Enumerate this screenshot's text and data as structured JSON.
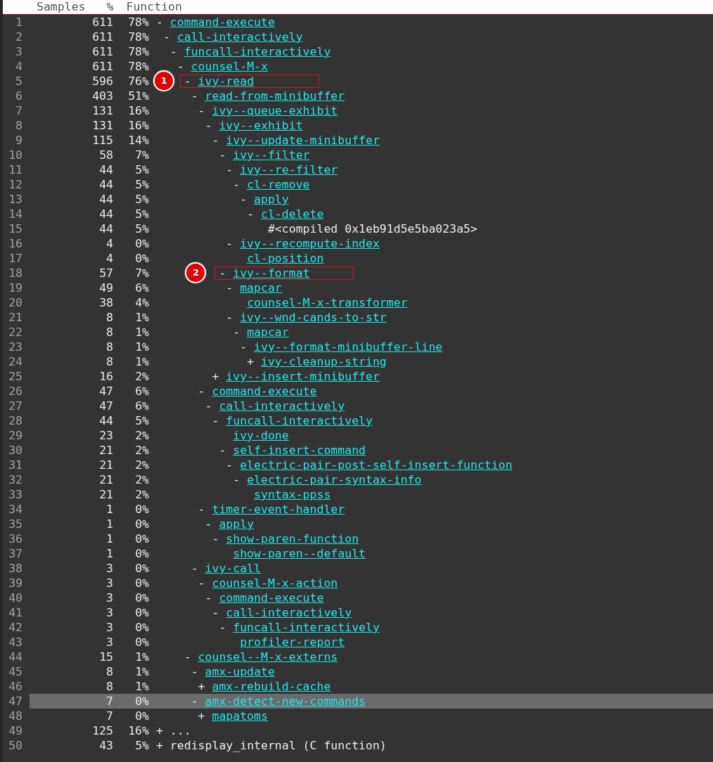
{
  "columns": [
    "Samples",
    "%",
    "Function"
  ],
  "tree": [
    {
      "line": "1",
      "samples": "611",
      "percent": "78%",
      "marker": "-",
      "name": "command-execute",
      "link": true,
      "selected": false,
      "children": [
        {
          "line": "2",
          "samples": "611",
          "percent": "78%",
          "marker": "-",
          "name": "call-interactively",
          "link": true,
          "selected": false,
          "children": [
            {
              "line": "3",
              "samples": "611",
              "percent": "78%",
              "marker": "-",
              "name": "funcall-interactively",
              "link": true,
              "selected": false,
              "children": [
                {
                  "line": "4",
                  "samples": "611",
                  "percent": "78%",
                  "marker": "-",
                  "name": "counsel-M-x",
                  "link": true,
                  "selected": false,
                  "children": [
                    {
                      "line": "5",
                      "samples": "596",
                      "percent": "76%",
                      "marker": "-",
                      "name": "ivy-read",
                      "link": true,
                      "selected": false,
                      "callout": "1",
                      "children": [
                        {
                          "line": "6",
                          "samples": "403",
                          "percent": "51%",
                          "marker": "-",
                          "name": "read-from-minibuffer",
                          "link": true,
                          "selected": false,
                          "children": [
                            {
                              "line": "7",
                              "samples": "131",
                              "percent": "16%",
                              "marker": "-",
                              "name": "ivy--queue-exhibit",
                              "link": true,
                              "selected": false,
                              "children": [
                                {
                                  "line": "8",
                                  "samples": "131",
                                  "percent": "16%",
                                  "marker": "-",
                                  "name": "ivy--exhibit",
                                  "link": true,
                                  "selected": false,
                                  "children": [
                                    {
                                      "line": "9",
                                      "samples": "115",
                                      "percent": "14%",
                                      "marker": "-",
                                      "name": "ivy--update-minibuffer",
                                      "link": true,
                                      "selected": false,
                                      "children": [
                                        {
                                          "line": "10",
                                          "samples": "58",
                                          "percent": "7%",
                                          "marker": "-",
                                          "name": "ivy--filter",
                                          "link": true,
                                          "selected": false,
                                          "children": [
                                            {
                                              "line": "11",
                                              "samples": "44",
                                              "percent": "5%",
                                              "marker": "-",
                                              "name": "ivy--re-filter",
                                              "link": true,
                                              "selected": false,
                                              "children": [
                                                {
                                                  "line": "12",
                                                  "samples": "44",
                                                  "percent": "5%",
                                                  "marker": "-",
                                                  "name": "cl-remove",
                                                  "link": true,
                                                  "selected": false,
                                                  "children": [
                                                    {
                                                      "line": "13",
                                                      "samples": "44",
                                                      "percent": "5%",
                                                      "marker": "-",
                                                      "name": "apply",
                                                      "link": true,
                                                      "selected": false,
                                                      "children": [
                                                        {
                                                          "line": "14",
                                                          "samples": "44",
                                                          "percent": "5%",
                                                          "marker": "-",
                                                          "name": "cl-delete",
                                                          "link": true,
                                                          "selected": false,
                                                          "children": [
                                                            {
                                                              "line": "15",
                                                              "samples": "44",
                                                              "percent": "5%",
                                                              "name": "#<compiled 0x1eb91d5e5ba023a5>",
                                                              "link": false,
                                                              "selected": false
                                                            }
                                                          ]
                                                        }
                                                      ]
                                                    }
                                                  ]
                                                }
                                              ]
                                            },
                                            {
                                              "line": "16",
                                              "samples": "4",
                                              "percent": "0%",
                                              "marker": "-",
                                              "name": "ivy--recompute-index",
                                              "link": true,
                                              "selected": false,
                                              "children": [
                                                {
                                                  "line": "17",
                                                  "samples": "4",
                                                  "percent": "0%",
                                                  "name": "cl-position",
                                                  "link": true,
                                                  "selected": false
                                                }
                                              ]
                                            }
                                          ]
                                        },
                                        {
                                          "line": "18",
                                          "samples": "57",
                                          "percent": "7%",
                                          "marker": "-",
                                          "name": "ivy--format",
                                          "link": true,
                                          "selected": false,
                                          "callout": "2",
                                          "children": [
                                            {
                                              "line": "19",
                                              "samples": "49",
                                              "percent": "6%",
                                              "marker": "-",
                                              "name": "mapcar",
                                              "link": true,
                                              "selected": false,
                                              "children": [
                                                {
                                                  "line": "20",
                                                  "samples": "38",
                                                  "percent": "4%",
                                                  "name": "counsel-M-x-transformer",
                                                  "link": true,
                                                  "selected": false
                                                }
                                              ]
                                            },
                                            {
                                              "line": "21",
                                              "samples": "8",
                                              "percent": "1%",
                                              "marker": "-",
                                              "name": "ivy--wnd-cands-to-str",
                                              "link": true,
                                              "selected": false,
                                              "children": [
                                                {
                                                  "line": "22",
                                                  "samples": "8",
                                                  "percent": "1%",
                                                  "marker": "-",
                                                  "name": "mapcar",
                                                  "link": true,
                                                  "selected": false,
                                                  "children": [
                                                    {
                                                      "line": "23",
                                                      "samples": "8",
                                                      "percent": "1%",
                                                      "marker": "-",
                                                      "name": "ivy--format-minibuffer-line",
                                                      "link": true,
                                                      "selected": false,
                                                      "children": [
                                                        {
                                                          "line": "24",
                                                          "samples": "8",
                                                          "percent": "1%",
                                                          "marker": "+",
                                                          "name": "ivy-cleanup-string",
                                                          "link": true,
                                                          "selected": false
                                                        }
                                                      ]
                                                    }
                                                  ]
                                                }
                                              ]
                                            }
                                          ]
                                        }
                                      ]
                                    },
                                    {
                                      "line": "25",
                                      "samples": "16",
                                      "percent": "2%",
                                      "marker": "+",
                                      "name": "ivy--insert-minibuffer",
                                      "link": true,
                                      "selected": false
                                    }
                                  ]
                                }
                              ]
                            },
                            {
                              "line": "26",
                              "samples": "47",
                              "percent": "6%",
                              "marker": "-",
                              "name": "command-execute",
                              "link": true,
                              "selected": false,
                              "children": [
                                {
                                  "line": "27",
                                  "samples": "47",
                                  "percent": "6%",
                                  "marker": "-",
                                  "name": "call-interactively",
                                  "link": true,
                                  "selected": false,
                                  "children": [
                                    {
                                      "line": "28",
                                      "samples": "44",
                                      "percent": "5%",
                                      "marker": "-",
                                      "name": "funcall-interactively",
                                      "link": true,
                                      "selected": false,
                                      "children": [
                                        {
                                          "line": "29",
                                          "samples": "23",
                                          "percent": "2%",
                                          "name": "ivy-done",
                                          "link": true,
                                          "selected": false
                                        },
                                        {
                                          "line": "30",
                                          "samples": "21",
                                          "percent": "2%",
                                          "marker": "-",
                                          "name": "self-insert-command",
                                          "link": true,
                                          "selected": false,
                                          "children": [
                                            {
                                              "line": "31",
                                              "samples": "21",
                                              "percent": "2%",
                                              "marker": "-",
                                              "name": "electric-pair-post-self-insert-function",
                                              "link": true,
                                              "selected": false,
                                              "children": [
                                                {
                                                  "line": "32",
                                                  "samples": "21",
                                                  "percent": "2%",
                                                  "marker": "-",
                                                  "name": "electric-pair-syntax-info",
                                                  "link": true,
                                                  "selected": false,
                                                  "children": [
                                                    {
                                                      "line": "33",
                                                      "samples": "21",
                                                      "percent": "2%",
                                                      "name": "syntax-ppss",
                                                      "link": true,
                                                      "selected": false
                                                    }
                                                  ]
                                                }
                                              ]
                                            }
                                          ]
                                        }
                                      ]
                                    }
                                  ]
                                }
                              ]
                            },
                            {
                              "line": "34",
                              "samples": "1",
                              "percent": "0%",
                              "marker": "-",
                              "name": "timer-event-handler",
                              "link": true,
                              "selected": false,
                              "children": [
                                {
                                  "line": "35",
                                  "samples": "1",
                                  "percent": "0%",
                                  "marker": "-",
                                  "name": "apply",
                                  "link": true,
                                  "selected": false,
                                  "children": [
                                    {
                                      "line": "36",
                                      "samples": "1",
                                      "percent": "0%",
                                      "marker": "-",
                                      "name": "show-paren-function",
                                      "link": true,
                                      "selected": false,
                                      "children": [
                                        {
                                          "line": "37",
                                          "samples": "1",
                                          "percent": "0%",
                                          "name": "show-paren--default",
                                          "link": true,
                                          "selected": false
                                        }
                                      ]
                                    }
                                  ]
                                }
                              ]
                            }
                          ]
                        },
                        {
                          "line": "38",
                          "samples": "3",
                          "percent": "0%",
                          "marker": "-",
                          "name": "ivy-call",
                          "link": true,
                          "selected": false,
                          "children": [
                            {
                              "line": "39",
                              "samples": "3",
                              "percent": "0%",
                              "marker": "-",
                              "name": "counsel-M-x-action",
                              "link": true,
                              "selected": false,
                              "children": [
                                {
                                  "line": "40",
                                  "samples": "3",
                                  "percent": "0%",
                                  "marker": "-",
                                  "name": "command-execute",
                                  "link": true,
                                  "selected": false,
                                  "children": [
                                    {
                                      "line": "41",
                                      "samples": "3",
                                      "percent": "0%",
                                      "marker": "-",
                                      "name": "call-interactively",
                                      "link": true,
                                      "selected": false,
                                      "children": [
                                        {
                                          "line": "42",
                                          "samples": "3",
                                          "percent": "0%",
                                          "marker": "-",
                                          "name": "funcall-interactively",
                                          "link": true,
                                          "selected": false,
                                          "children": [
                                            {
                                              "line": "43",
                                              "samples": "3",
                                              "percent": "0%",
                                              "name": "profiler-report",
                                              "link": true,
                                              "selected": false
                                            }
                                          ]
                                        }
                                      ]
                                    }
                                  ]
                                }
                              ]
                            }
                          ]
                        }
                      ]
                    },
                    {
                      "line": "44",
                      "samples": "15",
                      "percent": "1%",
                      "marker": "-",
                      "name": "counsel--M-x-externs",
                      "link": true,
                      "selected": false,
                      "children": [
                        {
                          "line": "45",
                          "samples": "8",
                          "percent": "1%",
                          "marker": "-",
                          "name": "amx-update",
                          "link": true,
                          "selected": false,
                          "children": [
                            {
                              "line": "46",
                              "samples": "8",
                              "percent": "1%",
                              "marker": "+",
                              "name": "amx-rebuild-cache",
                              "link": true,
                              "selected": false
                            }
                          ]
                        },
                        {
                          "line": "47",
                          "samples": "7",
                          "percent": "0%",
                          "marker": "-",
                          "name": "amx-detect-new-commands",
                          "link": true,
                          "selected": true,
                          "children": [
                            {
                              "line": "48",
                              "samples": "7",
                              "percent": "0%",
                              "marker": "+",
                              "name": "mapatoms",
                              "link": true,
                              "selected": false
                            }
                          ]
                        }
                      ]
                    }
                  ]
                }
              ]
            }
          ]
        }
      ]
    },
    {
      "line": "49",
      "samples": "125",
      "percent": "16%",
      "marker": "+",
      "name": "...",
      "link": false,
      "selected": false
    },
    {
      "line": "50",
      "samples": "43",
      "percent": "5%",
      "marker": "+",
      "name": "redisplay_internal (C function)",
      "link": false,
      "selected": false
    }
  ]
}
